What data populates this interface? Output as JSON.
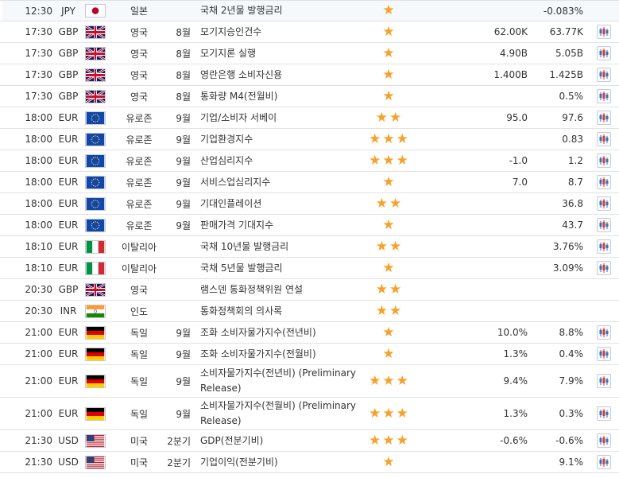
{
  "colors": {
    "star": "#f7a12a",
    "row_border": "#dfe3e8",
    "first_row_bg": "#f6f9fc"
  },
  "rows": [
    {
      "time": "12:30",
      "currency": "JPY",
      "flag": "jp",
      "country": "일본",
      "period": "",
      "event": "국채 2년물 발행금리",
      "stars": 1,
      "actual": "",
      "forecast": "-0.083%",
      "chart": false
    },
    {
      "time": "17:30",
      "currency": "GBP",
      "flag": "gb",
      "country": "영국",
      "period": "8월",
      "event": "모기지승인건수",
      "stars": 1,
      "actual": "62.00K",
      "forecast": "63.77K",
      "chart": true
    },
    {
      "time": "17:30",
      "currency": "GBP",
      "flag": "gb",
      "country": "영국",
      "period": "8월",
      "event": "모기지론 실행",
      "stars": 1,
      "actual": "4.90B",
      "forecast": "5.05B",
      "chart": true
    },
    {
      "time": "17:30",
      "currency": "GBP",
      "flag": "gb",
      "country": "영국",
      "period": "8월",
      "event": "영란은행 소비자신용",
      "stars": 1,
      "actual": "1.400B",
      "forecast": "1.425B",
      "chart": true
    },
    {
      "time": "17:30",
      "currency": "GBP",
      "flag": "gb",
      "country": "영국",
      "period": "8월",
      "event": "통화량 M4(전월비)",
      "stars": 1,
      "actual": "",
      "forecast": "0.5%",
      "chart": true
    },
    {
      "time": "18:00",
      "currency": "EUR",
      "flag": "eu",
      "country": "유로존",
      "period": "9월",
      "event": "기업/소비자 서베이",
      "stars": 2,
      "actual": "95.0",
      "forecast": "97.6",
      "chart": true
    },
    {
      "time": "18:00",
      "currency": "EUR",
      "flag": "eu",
      "country": "유로존",
      "period": "9월",
      "event": "기업환경지수",
      "stars": 3,
      "actual": "",
      "forecast": "0.83",
      "chart": true
    },
    {
      "time": "18:00",
      "currency": "EUR",
      "flag": "eu",
      "country": "유로존",
      "period": "9월",
      "event": "산업심리지수",
      "stars": 3,
      "actual": "-1.0",
      "forecast": "1.2",
      "chart": true
    },
    {
      "time": "18:00",
      "currency": "EUR",
      "flag": "eu",
      "country": "유로존",
      "period": "9월",
      "event": "서비스업심리지수",
      "stars": 1,
      "actual": "7.0",
      "forecast": "8.7",
      "chart": true
    },
    {
      "time": "18:00",
      "currency": "EUR",
      "flag": "eu",
      "country": "유로존",
      "period": "9월",
      "event": "기대인플레이션",
      "stars": 2,
      "actual": "",
      "forecast": "36.8",
      "chart": true
    },
    {
      "time": "18:00",
      "currency": "EUR",
      "flag": "eu",
      "country": "유로존",
      "period": "9월",
      "event": "판매가격 기대지수",
      "stars": 1,
      "actual": "",
      "forecast": "43.7",
      "chart": true
    },
    {
      "time": "18:10",
      "currency": "EUR",
      "flag": "it",
      "country": "이탈리아",
      "period": "",
      "event": "국채 10년물 발행금리",
      "stars": 2,
      "actual": "",
      "forecast": "3.76%",
      "chart": true
    },
    {
      "time": "18:10",
      "currency": "EUR",
      "flag": "it",
      "country": "이탈리아",
      "period": "",
      "event": "국채 5년물 발행금리",
      "stars": 1,
      "actual": "",
      "forecast": "3.09%",
      "chart": true
    },
    {
      "time": "20:30",
      "currency": "GBP",
      "flag": "gb",
      "country": "영국",
      "period": "",
      "event": "램스덴 통화정책위원 연설",
      "stars": 2,
      "actual": "",
      "forecast": "",
      "chart": false
    },
    {
      "time": "20:30",
      "currency": "INR",
      "flag": "in",
      "country": "인도",
      "period": "",
      "event": "통화정책회의 의사록",
      "stars": 2,
      "actual": "",
      "forecast": "",
      "chart": false
    },
    {
      "time": "21:00",
      "currency": "EUR",
      "flag": "de",
      "country": "독일",
      "period": "9월",
      "event": "조화 소비자물가지수(전년비)",
      "stars": 1,
      "actual": "10.0%",
      "forecast": "8.8%",
      "chart": true
    },
    {
      "time": "21:00",
      "currency": "EUR",
      "flag": "de",
      "country": "독일",
      "period": "9월",
      "event": "조화 소비자물가지수(전월비)",
      "stars": 1,
      "actual": "1.3%",
      "forecast": "0.4%",
      "chart": true
    },
    {
      "time": "21:00",
      "currency": "EUR",
      "flag": "de",
      "country": "독일",
      "period": "9월",
      "event": "소비자물가지수(전년비) (Preliminary Release)",
      "stars": 3,
      "actual": "9.4%",
      "forecast": "7.9%",
      "chart": true
    },
    {
      "time": "21:00",
      "currency": "EUR",
      "flag": "de",
      "country": "독일",
      "period": "9월",
      "event": "소비자물가지수(전월비) (Preliminary Release)",
      "stars": 3,
      "actual": "1.3%",
      "forecast": "0.3%",
      "chart": true
    },
    {
      "time": "21:30",
      "currency": "USD",
      "flag": "us",
      "country": "미국",
      "period": "2분기",
      "event": "GDP(전분기비)",
      "stars": 3,
      "actual": "-0.6%",
      "forecast": "-0.6%",
      "chart": true
    },
    {
      "time": "21:30",
      "currency": "USD",
      "flag": "us",
      "country": "미국",
      "period": "2분기",
      "event": "기업이익(전분기비)",
      "stars": 1,
      "actual": "",
      "forecast": "9.1%",
      "chart": true
    }
  ]
}
